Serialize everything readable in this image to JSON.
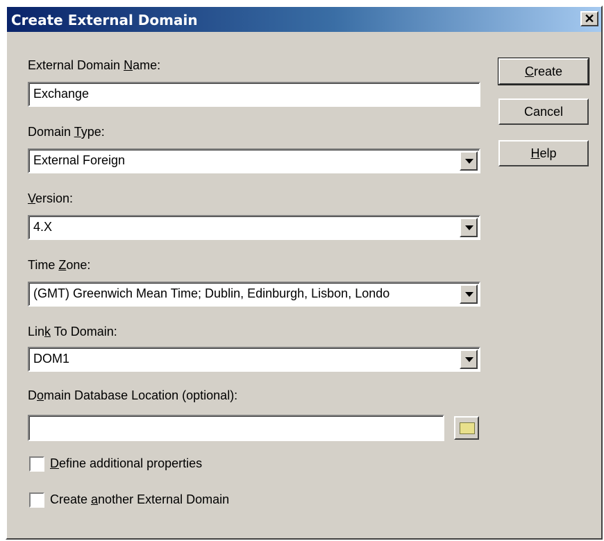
{
  "window": {
    "title": "Create External Domain",
    "close_glyph": "✕"
  },
  "labels": {
    "domain_name": {
      "pre": "External Domain ",
      "u": "N",
      "post": "ame:"
    },
    "domain_type": {
      "pre": "Domain ",
      "u": "T",
      "post": "ype:"
    },
    "version": {
      "pre": "",
      "u": "V",
      "post": "ersion:"
    },
    "time_zone": {
      "pre": "Time ",
      "u": "Z",
      "post": "one:"
    },
    "link_to_domain": {
      "pre": "Lin",
      "u": "k",
      "post": " To Domain:"
    },
    "db_location": {
      "pre": "D",
      "u": "o",
      "post": "main Database Location (optional):"
    }
  },
  "fields": {
    "domain_name": "Exchange",
    "domain_type": "External Foreign",
    "version": "4.X",
    "time_zone": "(GMT) Greenwich Mean Time; Dublin, Edinburgh, Lisbon, Londo",
    "link_to_domain": "DOM1",
    "db_location": ""
  },
  "buttons": {
    "create": {
      "pre": "",
      "u": "C",
      "post": "reate"
    },
    "cancel": {
      "pre": "Cancel",
      "u": "",
      "post": ""
    },
    "help": {
      "pre": "",
      "u": "H",
      "post": "elp"
    }
  },
  "checkboxes": {
    "define_props": {
      "pre": "",
      "u": "D",
      "post": "efine additional properties",
      "checked": false
    },
    "create_another": {
      "pre": "Create ",
      "u": "a",
      "post": "nother External Domain",
      "checked": false
    }
  },
  "icons": {
    "close": "close-icon",
    "dropdown": "chevron-down-icon",
    "browse": "folder-icon"
  },
  "colors": {
    "dialog_bg": "#d4d0c8",
    "title_start": "#0a246a",
    "title_end": "#a6caf0"
  }
}
